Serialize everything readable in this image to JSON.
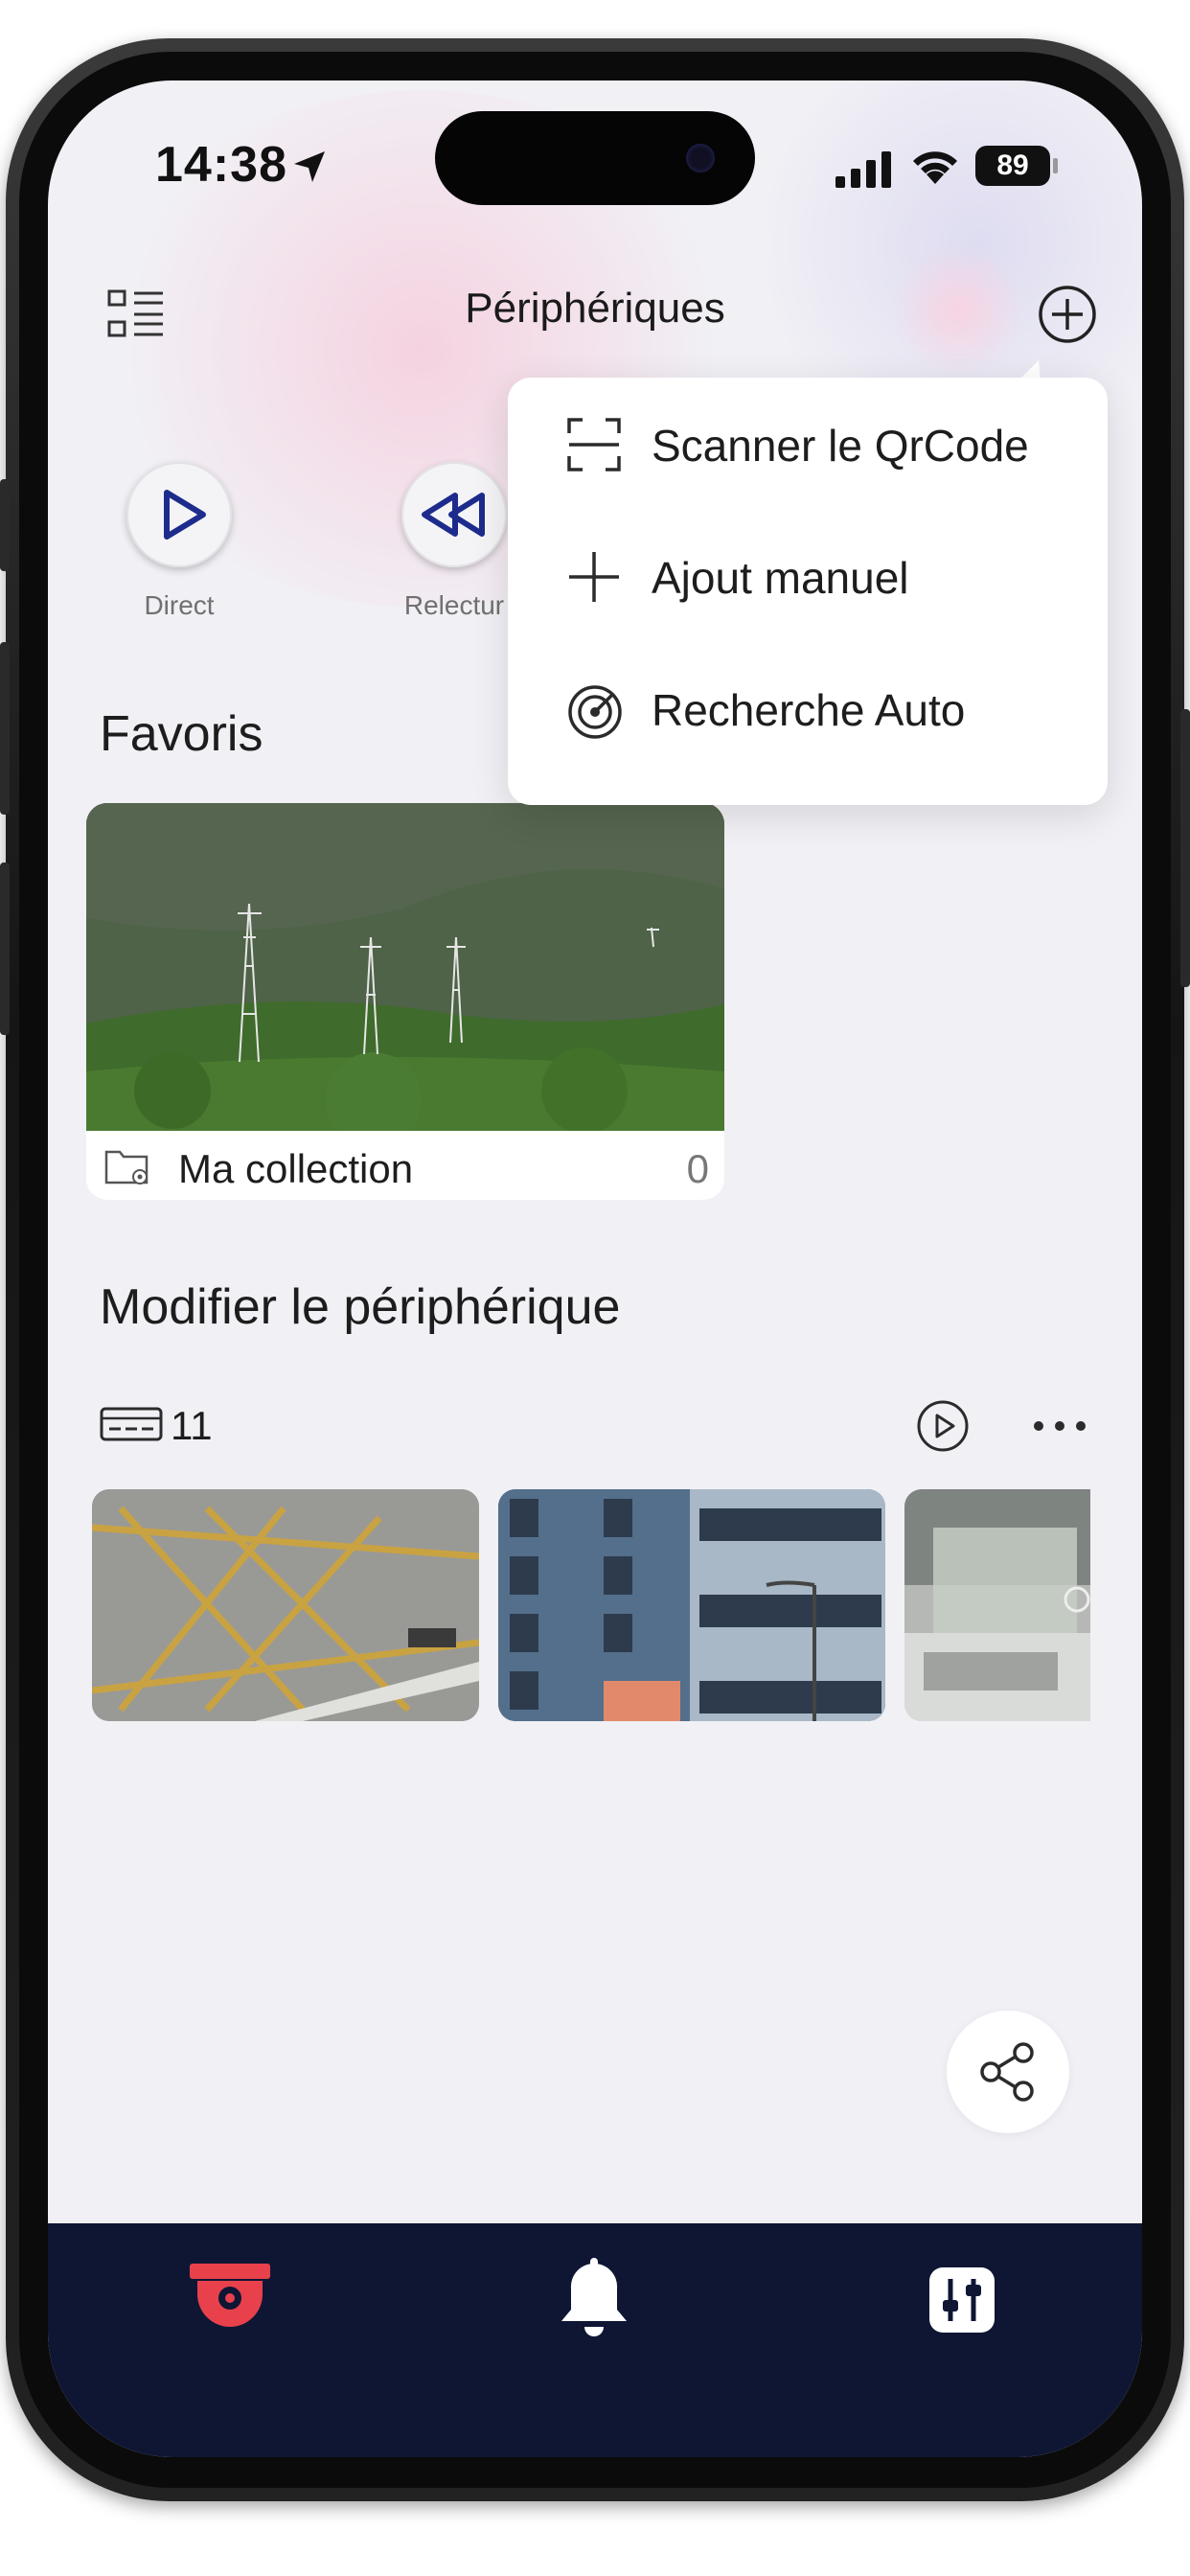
{
  "status_bar": {
    "time": "14:38",
    "battery": "89"
  },
  "nav": {
    "title": "Périphériques"
  },
  "quick_actions": [
    {
      "label": "Direct",
      "icon": "play-icon"
    },
    {
      "label": "Relectur",
      "icon": "rewind-icon"
    }
  ],
  "favorites": {
    "title": "Favoris",
    "card": {
      "label": "Ma collection",
      "count": "0"
    }
  },
  "devices": {
    "title": "Modifier le périphérique",
    "count": "11"
  },
  "popup_menu": {
    "items": [
      {
        "label": "Scanner le QrCode",
        "icon": "qr-scan-icon"
      },
      {
        "label": "Ajout manuel",
        "icon": "plus-icon"
      },
      {
        "label": "Recherche Auto",
        "icon": "radar-icon"
      }
    ]
  },
  "tab_bar": {
    "tabs": [
      {
        "icon": "camera-icon",
        "active": true,
        "color": "#e8414c"
      },
      {
        "icon": "bell-icon",
        "active": false,
        "color": "#ffffff"
      },
      {
        "icon": "sliders-icon",
        "active": false,
        "color": "#ffffff"
      }
    ]
  },
  "colors": {
    "tabbar": "#0f1634",
    "accent": "#e8414c",
    "play_blue": "#1d2c8c",
    "screen_bg": "#f1f0f5"
  }
}
